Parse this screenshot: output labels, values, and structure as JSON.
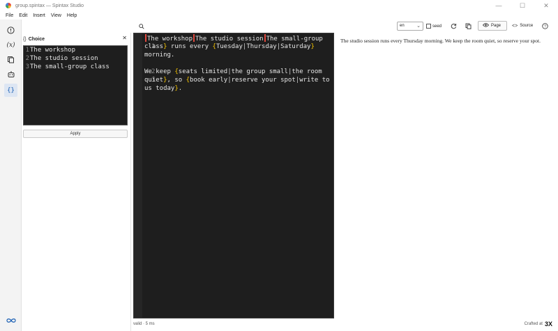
{
  "window": {
    "title": "group.spintax — Spintax Studio",
    "minimize": "—",
    "maximize": "☐",
    "close": "✕"
  },
  "menu": [
    "File",
    "Edit",
    "Insert",
    "View",
    "Help"
  ],
  "leftbar": {
    "items": [
      {
        "name": "lint-icon",
        "glyph": "!"
      },
      {
        "name": "variables-icon",
        "glyph": "(x)"
      },
      {
        "name": "snippets-icon",
        "glyph": "⧉"
      },
      {
        "name": "assistant-icon",
        "glyph": "🤖"
      },
      {
        "name": "choice-icon",
        "glyph": "{}"
      }
    ],
    "bottom_glyph": "∞"
  },
  "toolbar": {
    "language_value": "en",
    "seed_label": "seed",
    "page_label": "Page",
    "source_label": "Source",
    "search_glyph": "⌕",
    "refresh_glyph": "⟳",
    "copy_glyph": "⧉",
    "help_glyph": "?"
  },
  "choice_panel": {
    "title": "Choice",
    "close_glyph": "✕",
    "lines": [
      "The workshop",
      "The studio session",
      "The small-group class"
    ],
    "apply_label": "Apply"
  },
  "editor": {
    "line_numbers": [
      "1",
      "2",
      "3"
    ]
  },
  "preview": {
    "text": "The studio session runs every Thursday morning. We keep the room quiet, so reserve your spot."
  },
  "status": {
    "text": "valid · 5 ms",
    "crafted_label": "Crafted at",
    "crafted_logo": "3X"
  }
}
